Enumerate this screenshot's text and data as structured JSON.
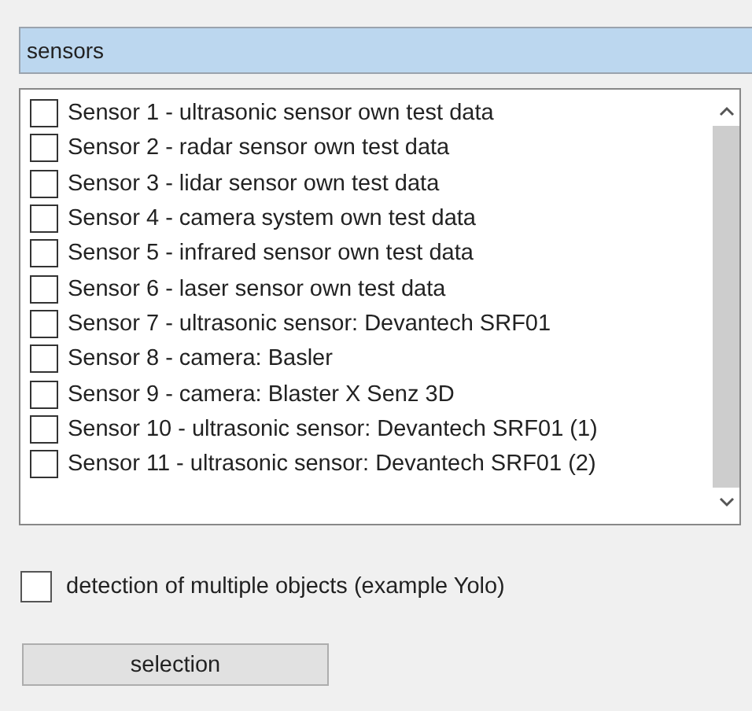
{
  "header": {
    "text": "sensors"
  },
  "sensors": [
    {
      "label": "Sensor 1 - ultrasonic sensor own test data",
      "checked": false
    },
    {
      "label": "Sensor 2 - radar sensor own test data",
      "checked": false
    },
    {
      "label": "Sensor 3 - lidar sensor own test data",
      "checked": false
    },
    {
      "label": "Sensor 4 - camera system own test data",
      "checked": false
    },
    {
      "label": "Sensor 5 - infrared sensor own test data",
      "checked": false
    },
    {
      "label": "Sensor 6 - laser sensor own test data",
      "checked": false
    },
    {
      "label": "Sensor 7 - ultrasonic sensor: Devantech SRF01",
      "checked": false
    },
    {
      "label": "Sensor 8 - camera: Basler",
      "checked": false
    },
    {
      "label": "Sensor 9 - camera: Blaster X Senz 3D",
      "checked": false
    },
    {
      "label": "Sensor 10 - ultrasonic sensor: Devantech SRF01 (1)",
      "checked": false
    },
    {
      "label": "Sensor 11 - ultrasonic sensor: Devantech SRF01 (2)",
      "checked": false
    }
  ],
  "option": {
    "label": "detection of multiple objects (example Yolo)",
    "checked": false
  },
  "button": {
    "label": "selection"
  }
}
